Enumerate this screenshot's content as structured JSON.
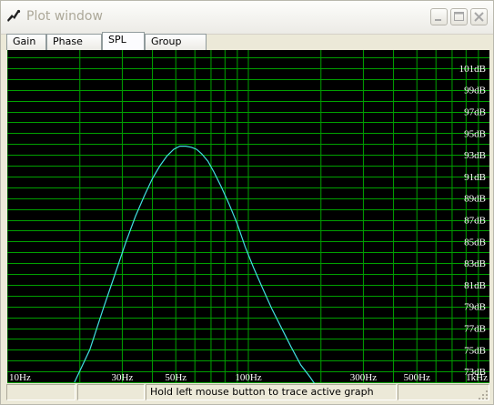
{
  "window": {
    "title": "Plot window",
    "buttons": {
      "minimize": "minimize",
      "maximize": "maximize",
      "close": "close"
    }
  },
  "tabs": [
    {
      "label": "Gain",
      "active": false
    },
    {
      "label": "Phase plot",
      "active": false
    },
    {
      "label": "SPL",
      "active": true
    },
    {
      "label": "Group delay",
      "active": false
    }
  ],
  "colors": {
    "plot_background": "#000000",
    "grid": "#00a000",
    "curve": "#40e0e0",
    "labels": "#ffffff"
  },
  "chart_data": {
    "type": "line",
    "x_scale": "log",
    "xlim": [
      10,
      1000
    ],
    "ylim": [
      72,
      102
    ],
    "x_tick_labels": [
      {
        "value": 10,
        "label": "10Hz"
      },
      {
        "value": 30,
        "label": "30Hz"
      },
      {
        "value": 50,
        "label": "50Hz"
      },
      {
        "value": 100,
        "label": "100Hz"
      },
      {
        "value": 300,
        "label": "300Hz"
      },
      {
        "value": 500,
        "label": "500Hz"
      },
      {
        "value": 1000,
        "label": "1kHz"
      }
    ],
    "y_tick_labels": [
      {
        "value": 101,
        "label": "101dB"
      },
      {
        "value": 99,
        "label": "99dB"
      },
      {
        "value": 97,
        "label": "97dB"
      },
      {
        "value": 95,
        "label": "95dB"
      },
      {
        "value": 93,
        "label": "93dB"
      },
      {
        "value": 91,
        "label": "91dB"
      },
      {
        "value": 89,
        "label": "89dB"
      },
      {
        "value": 87,
        "label": "87dB"
      },
      {
        "value": 85,
        "label": "85dB"
      },
      {
        "value": 83,
        "label": "83dB"
      },
      {
        "value": 81,
        "label": "81dB"
      },
      {
        "value": 79,
        "label": "79dB"
      },
      {
        "value": 77,
        "label": "77dB"
      },
      {
        "value": 75,
        "label": "75dB"
      },
      {
        "value": 73,
        "label": "73dB"
      }
    ],
    "grid": true,
    "y_grid_step": 1,
    "series": [
      {
        "x": [
          19,
          22,
          25,
          28,
          31,
          34,
          37,
          40,
          43,
          46,
          49,
          52,
          55,
          58,
          61,
          64,
          68,
          72,
          77,
          83,
          90,
          97,
          105,
          115,
          125,
          138,
          150,
          165,
          180,
          200
        ],
        "y": [
          72,
          75,
          78.8,
          82,
          84.9,
          87.3,
          89.2,
          90.8,
          92,
          92.9,
          93.5,
          93.8,
          93.8,
          93.7,
          93.5,
          93.1,
          92.4,
          91.4,
          90.1,
          88.5,
          86.6,
          84.5,
          82.6,
          80.6,
          78.8,
          76.9,
          75.3,
          73.6,
          72.5,
          71
        ]
      }
    ]
  },
  "statusbar": {
    "cells": [
      "",
      "",
      "Hold left mouse button to trace active graph",
      ""
    ]
  }
}
